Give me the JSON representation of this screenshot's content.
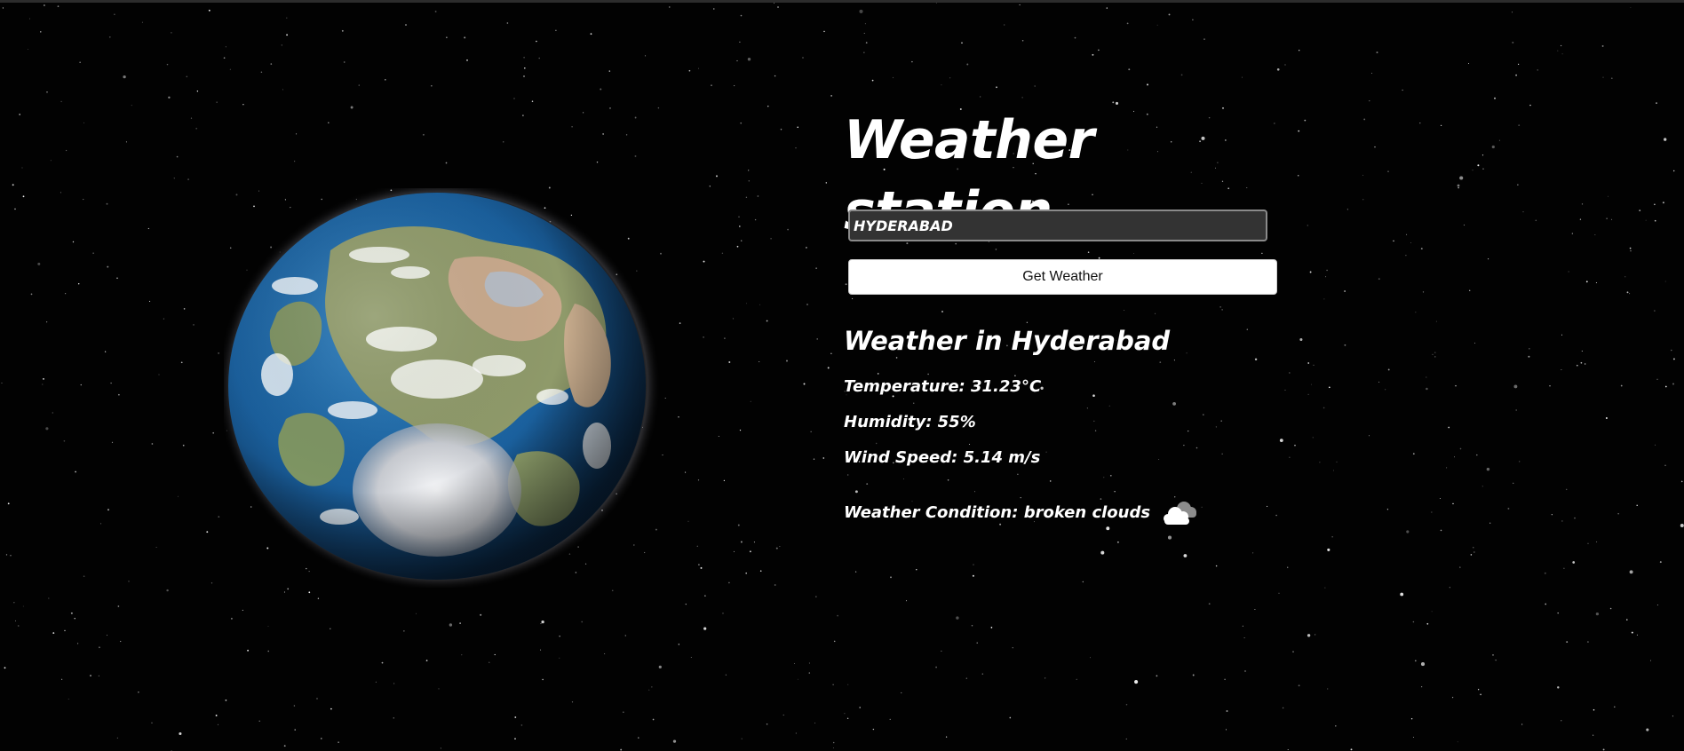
{
  "app": {
    "title": "Weather station"
  },
  "search": {
    "value": "HYDERABAD",
    "button_label": "Get Weather"
  },
  "result": {
    "heading": "Weather in Hyderabad",
    "temperature": "Temperature: 31.23°C",
    "humidity": "Humidity: 55%",
    "wind_speed": "Wind Speed: 5.14 m/s",
    "condition": "Weather Condition: broken clouds",
    "condition_icon": "broken-clouds-icon"
  },
  "colors": {
    "background": "#020202",
    "text": "#ffffff",
    "input_bg": "#333333",
    "button_bg": "#ffffff"
  }
}
